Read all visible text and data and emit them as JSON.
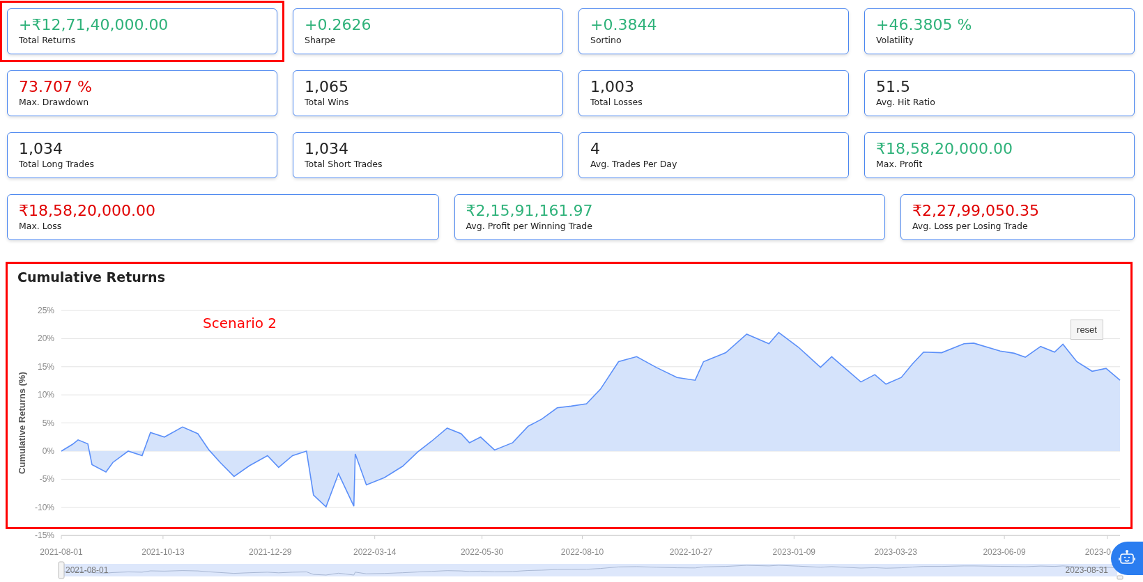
{
  "stats": [
    {
      "value": "+₹12,71,40,000.00",
      "label": "Total Returns",
      "color": "#2fb27a",
      "highlighted": true
    },
    {
      "value": "+0.2626",
      "label": "Sharpe",
      "color": "#2fb27a",
      "highlighted": false
    },
    {
      "value": "+0.3844",
      "label": "Sortino",
      "color": "#2fb27a",
      "highlighted": false
    },
    {
      "value": "+46.3805 %",
      "label": "Volatility",
      "color": "#2fb27a",
      "highlighted": false
    },
    {
      "value": "73.707 %",
      "label": "Max. Drawdown",
      "color": "#e00000",
      "highlighted": false
    },
    {
      "value": "1,065",
      "label": "Total Wins",
      "color": "#222222",
      "highlighted": false
    },
    {
      "value": "1,003",
      "label": "Total Losses",
      "color": "#222222",
      "highlighted": false
    },
    {
      "value": "51.5",
      "label": "Avg. Hit Ratio",
      "color": "#222222",
      "highlighted": false
    },
    {
      "value": "1,034",
      "label": "Total Long Trades",
      "color": "#222222",
      "highlighted": false
    },
    {
      "value": "1,034",
      "label": "Total Short Trades",
      "color": "#222222",
      "highlighted": false
    },
    {
      "value": "4",
      "label": "Avg. Trades Per Day",
      "color": "#222222",
      "highlighted": false
    },
    {
      "value": "₹18,58,20,000.00",
      "label": "Max. Profit",
      "color": "#2fb27a",
      "highlighted": false
    }
  ],
  "wide_stats": [
    {
      "value": "₹18,58,20,000.00",
      "label": "Max. Loss",
      "color": "#e00000"
    },
    {
      "value": "₹2,15,91,161.97",
      "label": "Avg. Profit per Winning Trade",
      "color": "#2fb27a"
    },
    {
      "value": "₹2,27,99,050.35",
      "label": "Avg. Loss per Losing Trade",
      "color": "#e00000"
    }
  ],
  "chart": {
    "title": "Cumulative Returns",
    "highlighted": true,
    "annotation": "Scenario 2",
    "reset_label": "reset",
    "navigator": {
      "start_label": "2021-08-01",
      "end_label": "2023-08-31"
    },
    "chart_data": {
      "type": "area",
      "grid": true,
      "ylabel": "Cumulative Returns (%)",
      "xlim": [
        "2021-08-01",
        "2023-08-31"
      ],
      "ylim": [
        -15,
        25
      ],
      "yticks": [
        {
          "value": -15,
          "label": "-15%"
        },
        {
          "value": -10,
          "label": "-10%"
        },
        {
          "value": -5,
          "label": "-5%"
        },
        {
          "value": 0,
          "label": "0%"
        },
        {
          "value": 5,
          "label": "5%"
        },
        {
          "value": 10,
          "label": "10%"
        },
        {
          "value": 15,
          "label": "15%"
        },
        {
          "value": 20,
          "label": "20%"
        },
        {
          "value": 25,
          "label": "25%"
        }
      ],
      "xticks": [
        {
          "value": "2021-08-01",
          "label": "2021-08-01"
        },
        {
          "value": "2021-10-13",
          "label": "2021-10-13"
        },
        {
          "value": "2021-12-29",
          "label": "2021-12-29"
        },
        {
          "value": "2022-03-14",
          "label": "2022-03-14"
        },
        {
          "value": "2022-05-30",
          "label": "2022-05-30"
        },
        {
          "value": "2022-08-10",
          "label": "2022-08-10"
        },
        {
          "value": "2022-10-27",
          "label": "2022-10-27"
        },
        {
          "value": "2023-01-09",
          "label": "2023-01-09"
        },
        {
          "value": "2023-03-23",
          "label": "2023-03-23"
        },
        {
          "value": "2023-06-09",
          "label": "2023-06-09"
        },
        {
          "value": "2023-08-22",
          "label": "2023-0"
        }
      ],
      "x": [
        "2021-08-01",
        "2021-08-09",
        "2021-08-13",
        "2021-08-20",
        "2021-08-23",
        "2021-09-02",
        "2021-09-07",
        "2021-09-18",
        "2021-09-28",
        "2021-10-04",
        "2021-10-14",
        "2021-10-27",
        "2021-11-07",
        "2021-11-15",
        "2021-11-23",
        "2021-12-03",
        "2021-12-14",
        "2021-12-27",
        "2022-01-04",
        "2022-01-14",
        "2022-01-24",
        "2022-01-29",
        "2022-02-07",
        "2022-02-16",
        "2022-02-27",
        "2022-02-28",
        "2022-03-08",
        "2022-03-21",
        "2022-04-03",
        "2022-04-14",
        "2022-04-24",
        "2022-05-05",
        "2022-05-15",
        "2022-05-21",
        "2022-05-29",
        "2022-06-08",
        "2022-06-21",
        "2022-07-02",
        "2022-07-12",
        "2022-07-23",
        "2022-08-02",
        "2022-08-13",
        "2022-08-23",
        "2022-09-05",
        "2022-09-18",
        "2022-10-02",
        "2022-10-17",
        "2022-10-30",
        "2022-11-05",
        "2022-11-21",
        "2022-12-06",
        "2022-12-22",
        "2022-12-29",
        "2023-01-12",
        "2023-01-28",
        "2023-02-05",
        "2023-02-26",
        "2023-03-08",
        "2023-03-16",
        "2023-03-27",
        "2023-04-04",
        "2023-04-12",
        "2023-04-25",
        "2023-05-11",
        "2023-05-18",
        "2023-06-06",
        "2023-06-16",
        "2023-06-24",
        "2023-07-05",
        "2023-07-15",
        "2023-07-21",
        "2023-07-31",
        "2023-08-11",
        "2023-08-21",
        "2023-08-31"
      ],
      "series": [
        {
          "color": "#5b8ff9",
          "values": [
            0,
            1.2,
            2,
            1.3,
            -2.4,
            -3.7,
            -2,
            0,
            -0.8,
            3.3,
            2.5,
            4.3,
            3.1,
            0.2,
            -2,
            -4.5,
            -2.6,
            -0.8,
            -2.9,
            -0.8,
            0,
            -7.8,
            -9.9,
            -4,
            -9.8,
            -0.5,
            -6,
            -4.7,
            -2.7,
            -0.1,
            1.8,
            4.1,
            3.1,
            1.5,
            2.5,
            0.2,
            1.5,
            4.4,
            5.7,
            7.7,
            8,
            8.4,
            11,
            15.9,
            16.8,
            14.9,
            13.1,
            12.6,
            15.9,
            17.5,
            20.8,
            19.1,
            21.1,
            18.5,
            14.9,
            16.8,
            12.3,
            13.6,
            11.9,
            13.1,
            15.5,
            17.6,
            17.5,
            19.1,
            19.2,
            17.8,
            17.4,
            16.7,
            18.6,
            17.6,
            19,
            15.9,
            14.2,
            14.7,
            12.6
          ]
        }
      ]
    }
  }
}
